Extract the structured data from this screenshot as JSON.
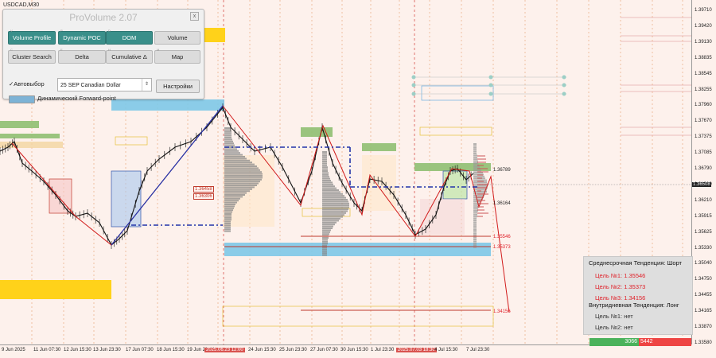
{
  "symbol": "USDCAD,M30",
  "panel": {
    "title": "ProVolume 2.07",
    "close": "x",
    "buttons": [
      {
        "key": "volume_profile",
        "label": "Volume Profile",
        "style": "teal",
        "cap": "V"
      },
      {
        "key": "dynamic_poc",
        "label": "Dynamic POC",
        "style": "teal",
        "cap": "P"
      },
      {
        "key": "dom",
        "label": "DOM",
        "style": "teal",
        "cap": "D"
      },
      {
        "key": "volume",
        "label": "Volume",
        "style": "grey",
        "cap": ""
      },
      {
        "key": "cluster_search",
        "label": "Cluster Search",
        "style": "grey",
        "cap": "C"
      },
      {
        "key": "delta",
        "label": "Delta",
        "style": "grey",
        "cap": "E"
      },
      {
        "key": "cumulative_delta",
        "label": "Cumulative Δ",
        "style": "grey",
        "cap": "H"
      },
      {
        "key": "map",
        "label": "Map",
        "style": "grey",
        "cap": "M"
      }
    ],
    "autoselect_label": "Автовыбор",
    "autoselect_mark": "✓",
    "contract": "25 SEP Canadian Dollar",
    "settings_label": "Настройки",
    "forward_point_label": "Динамический Forward-point"
  },
  "price_axis": {
    "ticks": [
      "1.39710",
      "1.39420",
      "1.39130",
      "1.38835",
      "1.38545",
      "1.38255",
      "1.37960",
      "1.37670",
      "1.37375",
      "1.37085",
      "1.36790",
      "1.36500",
      "1.36210",
      "1.35915",
      "1.35625",
      "1.35330",
      "1.35040",
      "1.34750",
      "1.34455",
      "1.34165",
      "1.33870",
      "1.33580"
    ],
    "current": "1.36508"
  },
  "time_axis": {
    "ticks": [
      {
        "label": "9 Jun 2025",
        "red": false
      },
      {
        "label": "11 Jun 07:30",
        "red": false
      },
      {
        "label": "12 Jun 15:30",
        "red": false
      },
      {
        "label": "13 Jun 23:30",
        "red": false
      },
      {
        "label": "17 Jun 07:30",
        "red": false
      },
      {
        "label": "18 Jun 15:30",
        "red": false
      },
      {
        "label": "19 Jun 23:30",
        "red": false
      },
      {
        "label": "2025.06.23 12:00",
        "red": true
      },
      {
        "label": "24 Jun 15:30",
        "red": false
      },
      {
        "label": "25 Jun 23:30",
        "red": false
      },
      {
        "label": "27 Jun 07:30",
        "red": false
      },
      {
        "label": "30 Jun 15:30",
        "red": false
      },
      {
        "label": "1 Jul 23:30",
        "red": false
      },
      {
        "label": "2025.07.03 18:30",
        "red": true
      },
      {
        "label": "4 Jul 15:30",
        "red": false
      },
      {
        "label": "7 Jul 23:30",
        "red": false
      }
    ]
  },
  "chart_labels": {
    "level_136458": "1.36458",
    "level_136306": "1.36306",
    "level_136789": "1.36789",
    "level_136164": "1.36164",
    "level_135546": "1.35546",
    "level_135373": "1.35373",
    "level_134156": "1.34156"
  },
  "trend_box": {
    "mid_title": "Среднесрочная Тенденция: Шорт",
    "targets": [
      {
        "label": "Цель №1: 1.35546"
      },
      {
        "label": "Цель №2: 1.35373"
      },
      {
        "label": "Цель №3: 1.34156"
      }
    ],
    "intraday_title": "Внутридневная Тенденция: Лонг",
    "intraday_targets": [
      {
        "label": "Цель №1: нет"
      },
      {
        "label": "Цель №2: нет"
      }
    ]
  },
  "volume_bar": {
    "buy": "3066",
    "sell": "5442"
  },
  "colors": {
    "bg": "#fdf1ec",
    "bull": "#1a1a1a",
    "accent_red": "#e0212a",
    "blue_line": "#2233aa",
    "teal": "#3a8f8a"
  }
}
